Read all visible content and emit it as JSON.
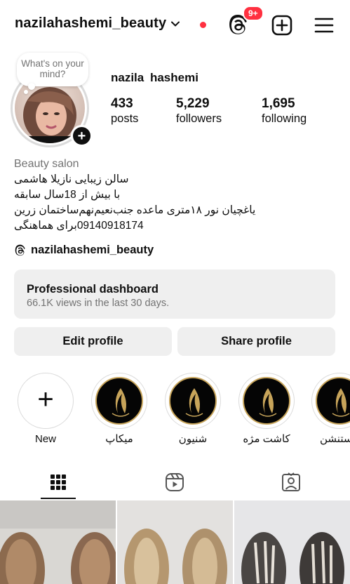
{
  "header": {
    "username": "nazilahashemi_beauty",
    "notifications_badge": "9+"
  },
  "profile": {
    "note_bubble": "What's on your mind?",
    "full_name": "nazila  hashemi",
    "stats": [
      {
        "value": "433",
        "label": "posts"
      },
      {
        "value": "5,229",
        "label": "followers"
      },
      {
        "value": "1,695",
        "label": "following"
      }
    ],
    "category": "Beauty salon",
    "bio_lines": [
      "سالن زیبایی نازیلا هاشمی",
      "با بیش از 18سال سابقه",
      "یاغچیان نور ۱۸متری ماعده جنب‌نعیم‌نهم‌ساختمان زرین",
      "09140918174برای هماهنگی"
    ],
    "threads_handle": "nazilahashemi_beauty"
  },
  "dashboard": {
    "title": "Professional dashboard",
    "subtitle": "66.1K views in the last 30 days."
  },
  "actions": {
    "edit_label": "Edit profile",
    "share_label": "Share profile"
  },
  "highlights": [
    {
      "label": "New"
    },
    {
      "label": "میکاپ"
    },
    {
      "label": "شنیون"
    },
    {
      "label": "کاشت مژه"
    },
    {
      "label": "ستنشن"
    }
  ],
  "tabs": [
    "grid-icon",
    "reels-icon",
    "tagged-icon"
  ],
  "colors": {
    "accent_red": "#ff3040",
    "button_bg": "#efefef",
    "muted_text": "#737373",
    "highlight_gold": "#c7a45a"
  }
}
